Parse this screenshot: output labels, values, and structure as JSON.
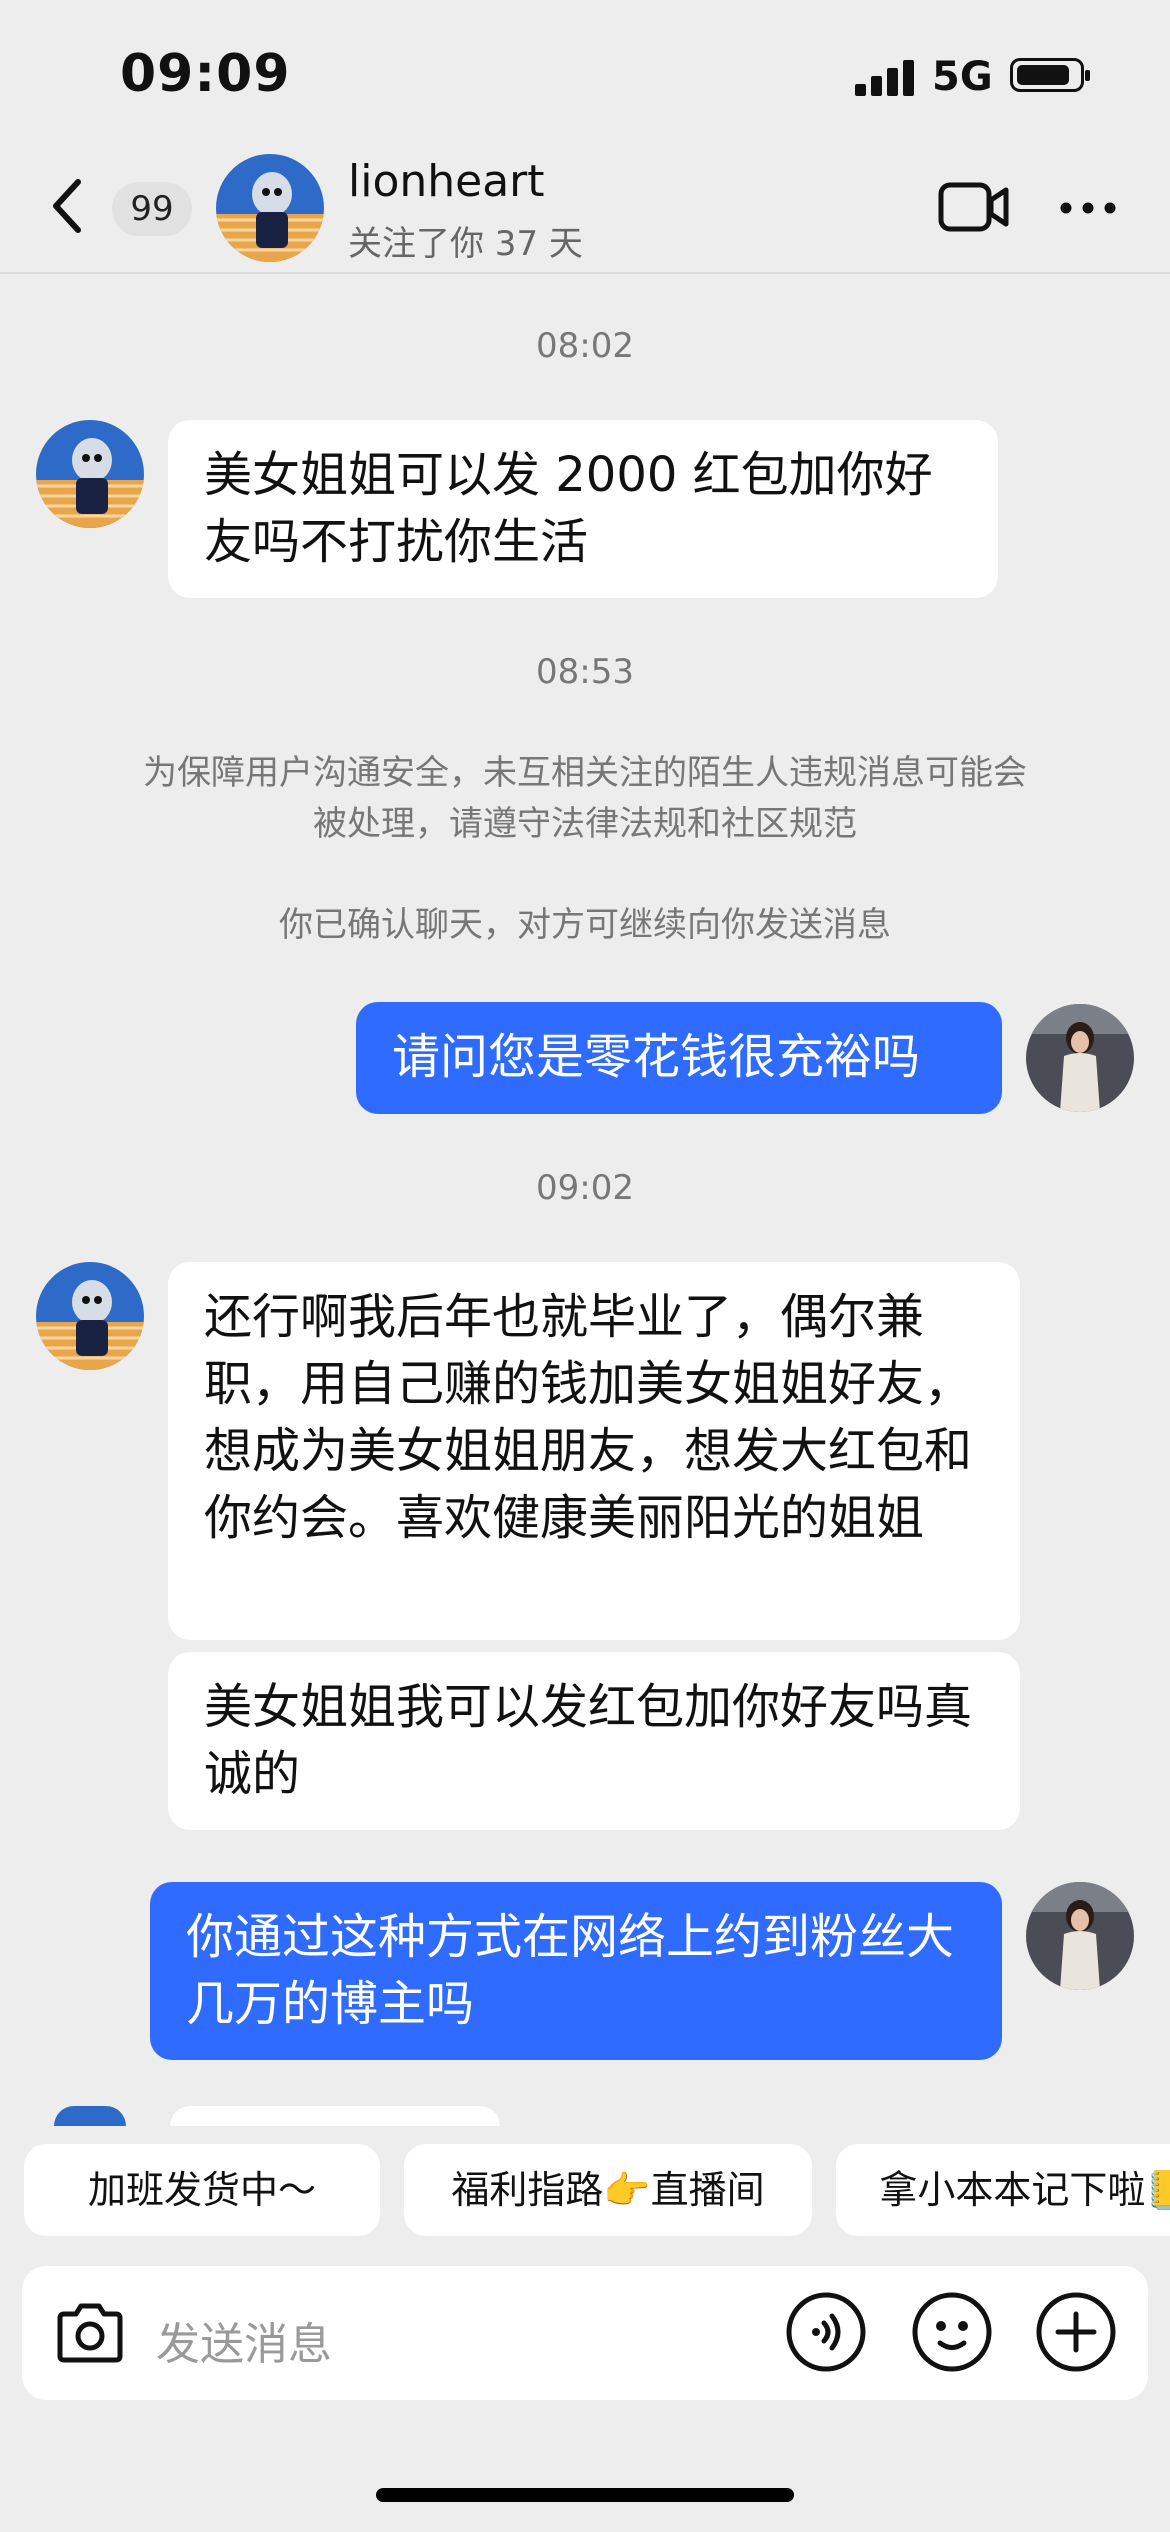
{
  "status": {
    "time": "09:09",
    "network": "5G"
  },
  "header": {
    "unread_count": "99",
    "name": "lionheart",
    "subtitle": "关注了你 37 天",
    "icons": [
      "back-icon",
      "video-call-icon",
      "more-icon"
    ]
  },
  "messages": {
    "t1": "08:02",
    "m1": "美女姐姐可以发 2000 红包加你好友吗不打扰你生活",
    "t2": "08:53",
    "notice": "为保障用户沟通安全，未互相关注的陌生人违规消息可能会被处理，请遵守法律法规和社区规范",
    "confirm": "你已确认聊天，对方可继续向你发送消息",
    "m2": "请问您是零花钱很充裕吗",
    "t3": "09:02",
    "m3": "还行啊我后年也就毕业了，偶尔兼职，用自己赚的钱加美女姐姐好友，想成为美女姐姐朋友，想发大红包和你约会。喜欢健康美丽阳光的姐姐",
    "m4": "美女姐姐我可以发红包加你好友吗真诚的",
    "m5": "你通过这种方式在网络上约到粉丝大几万的博主吗"
  },
  "quick_replies": [
    "加班发货中～",
    "福利指路👉直播间",
    "拿小本本记下啦📒"
  ],
  "input": {
    "placeholder": "发送消息"
  },
  "colors": {
    "background": "#ededed",
    "outgoing_bubble": "#2f6bff",
    "incoming_bubble": "#ffffff"
  }
}
